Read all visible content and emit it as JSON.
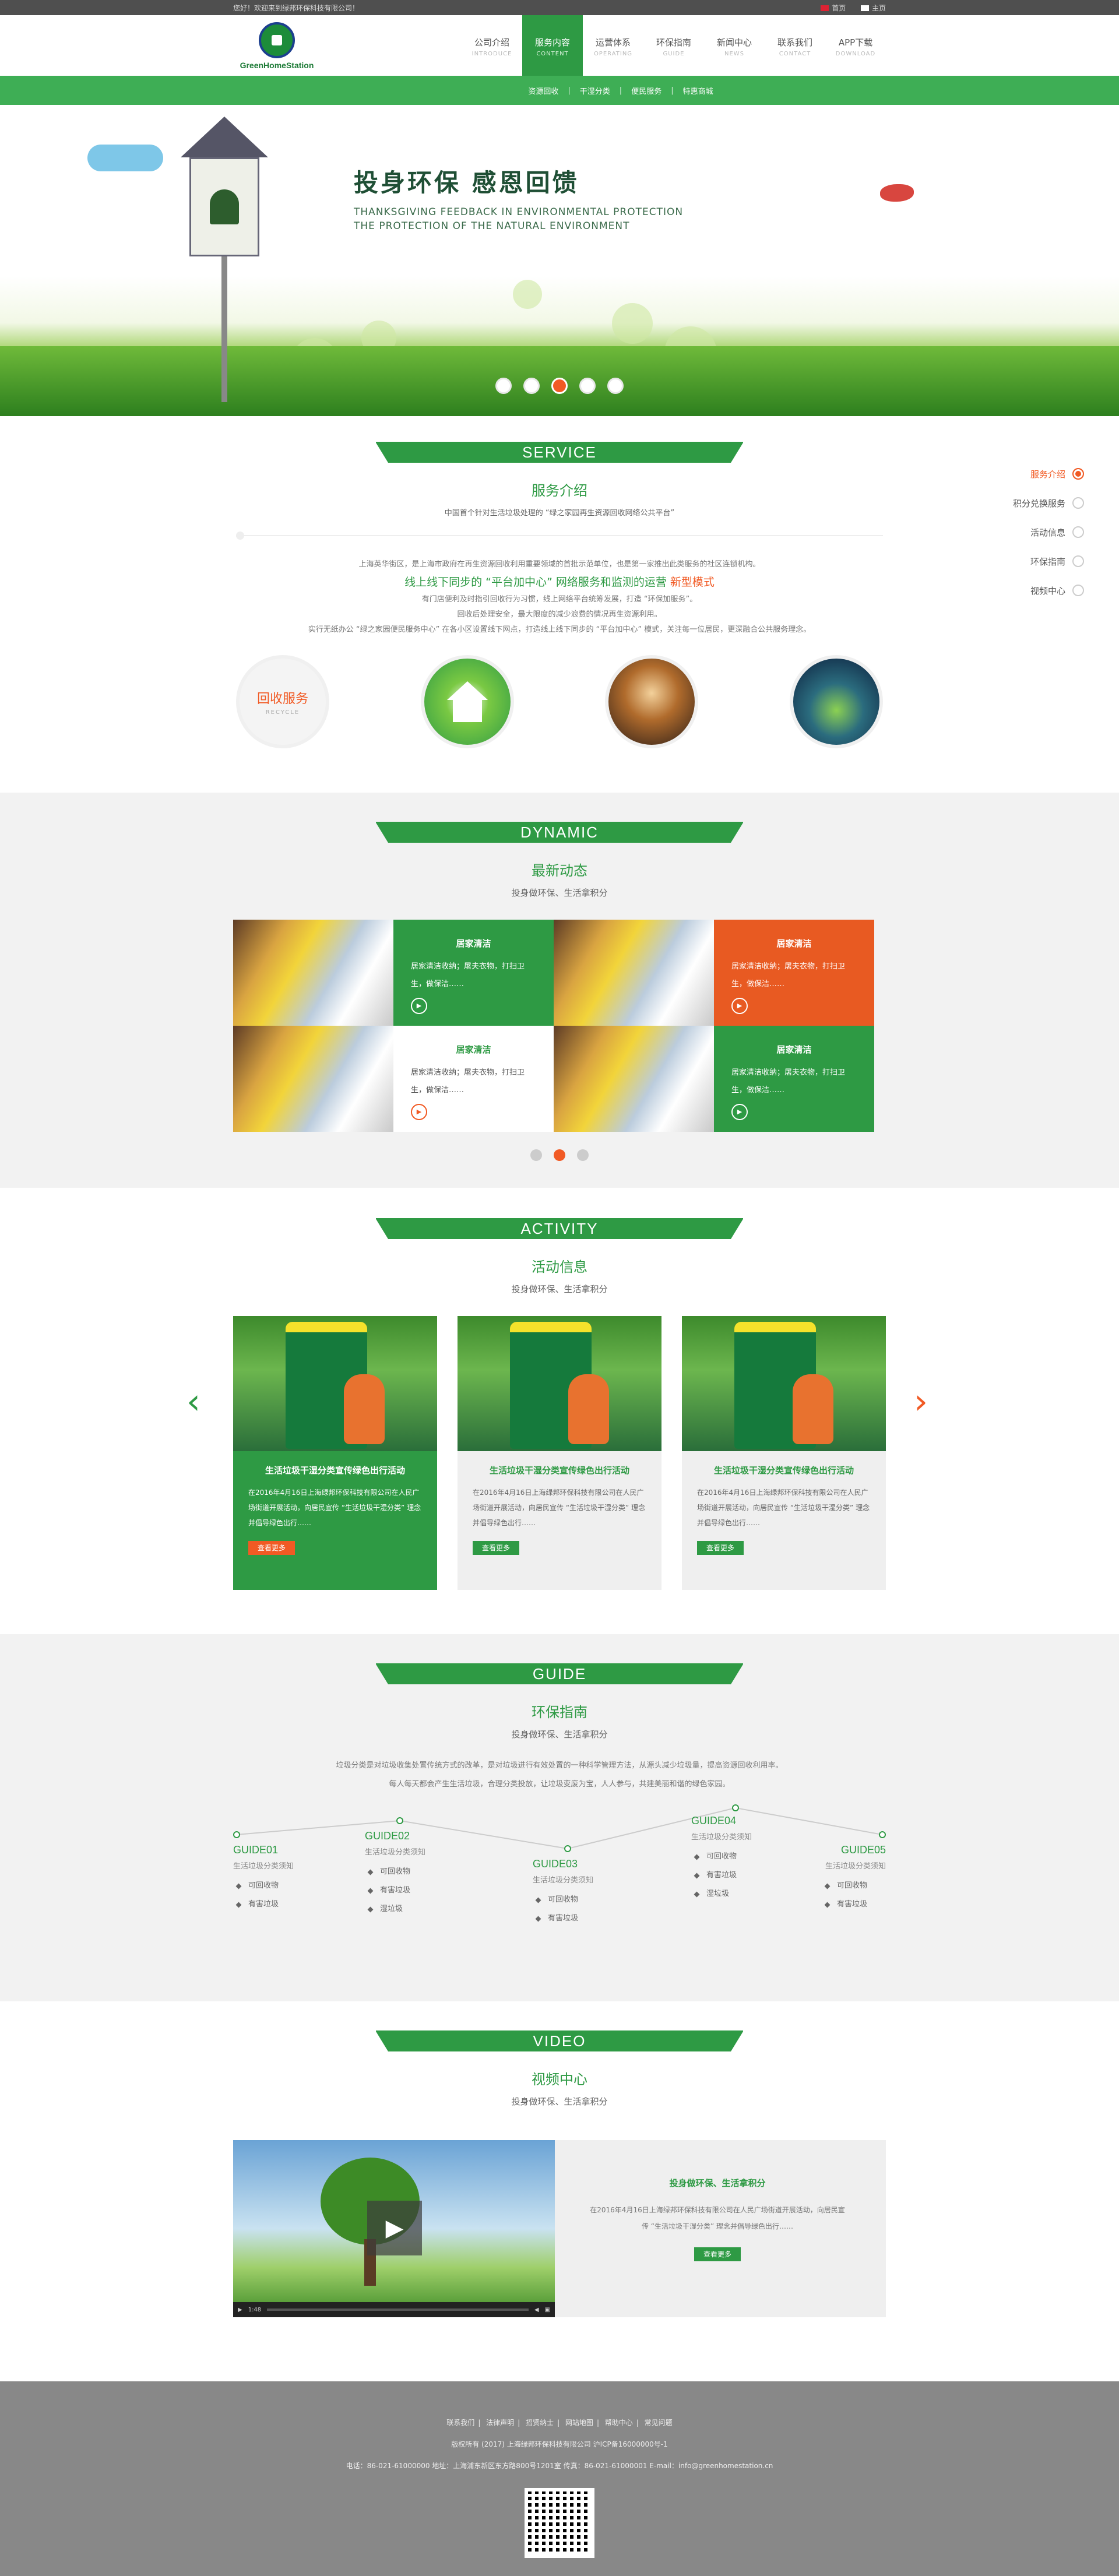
{
  "topbar": {
    "welcome": "您好！欢迎来到绿邦环保科技有限公司！",
    "lang_cn": "首页",
    "lang_en": "主页"
  },
  "logo": {
    "text": "GreenHomeStation"
  },
  "nav": [
    {
      "cn": "公司介绍",
      "en": "INTRODUCE"
    },
    {
      "cn": "服务内容",
      "en": "CONTENT"
    },
    {
      "cn": "运营体系",
      "en": "OPERATING"
    },
    {
      "cn": "环保指南",
      "en": "GUIDE"
    },
    {
      "cn": "新闻中心",
      "en": "NEWS"
    },
    {
      "cn": "联系我们",
      "en": "CONTACT"
    },
    {
      "cn": "APP下载",
      "en": "DOWNLOAD"
    }
  ],
  "subnav": [
    "资源回收",
    "干湿分类",
    "便民服务",
    "特惠商城"
  ],
  "banner": {
    "title": "投身环保 感恩回馈",
    "en1": "THANKSGIVING FEEDBACK IN ENVIRONMENTAL PROTECTION",
    "en2": "THE PROTECTION OF THE NATURAL ENVIRONMENT",
    "active_slide": 3
  },
  "service": {
    "ribbon": "SERVICE",
    "title": "服务介绍",
    "sub": "中国首个针对生活垃圾处理的 “绿之家园再生资源回收网络公共平台”",
    "p1": "上海英华街区，是上海市政府在再生资源回收利用重要领域的首批示范单位，也是第一家推出此类服务的社区连锁机构。",
    "highlight_a": "线上线下同步的 “平台加中心” 网络服务和监测的运营",
    "highlight_b": "新型模式",
    "p2": "有门店便利及时指引回收行为习惯，线上网络平台统筹发展，打造 “环保加服务”。",
    "p3": "回收后处理安全，最大限度的减少浪费的情况再生资源利用。",
    "p4": "实行无纸办公 “绿之家园便民服务中心” 在各小区设置线下网点，打造线上线下同步的 “平台加中心” 模式，关注每一位居民，更深融合公共服务理念。",
    "circle1": "回收服务",
    "circle1_en": "RECYCLE",
    "side": [
      "服务介绍",
      "积分兑换服务",
      "活动信息",
      "环保指南",
      "视频中心"
    ]
  },
  "dynamic": {
    "ribbon": "DYNAMIC",
    "title": "最新动态",
    "sub": "投身做环保、生活拿积分",
    "card_title": "居家清洁",
    "card_text": "居家清洁收纳；屠夫衣物，打扫卫生，做保洁……",
    "page": 2
  },
  "activity": {
    "ribbon": "ACTIVITY",
    "title": "活动信息",
    "sub": "投身做环保、生活拿积分",
    "item_title": "生活垃圾干湿分类宣传绿色出行活动",
    "item_text": "在2016年4月16日上海绿邦环保科技有限公司在人民广场街道开展活动，向居民宣传 “生活垃圾干湿分类” 理念并倡导绿色出行……",
    "more": "查看更多"
  },
  "guide": {
    "ribbon": "GUIDE",
    "title": "环保指南",
    "sub": "投身做环保、生活拿积分",
    "text1": "垃圾分类是对垃圾收集处置传统方式的改革，是对垃圾进行有效处置的一种科学管理方法，从源头减少垃圾量，提高资源回收利用率。",
    "text2": "每人每天都会产生生活垃圾，合理分类投放，让垃圾变废为宝，人人参与，共建美丽和谐的绿色家园。",
    "steps": [
      {
        "label": "GUIDE01",
        "sub": "生活垃圾分类须知",
        "items": [
          "可回收物",
          "有害垃圾"
        ]
      },
      {
        "label": "GUIDE02",
        "sub": "生活垃圾分类须知",
        "items": [
          "可回收物",
          "有害垃圾",
          "湿垃圾"
        ]
      },
      {
        "label": "GUIDE03",
        "sub": "生活垃圾分类须知",
        "items": [
          "可回收物",
          "有害垃圾"
        ]
      },
      {
        "label": "GUIDE04",
        "sub": "生活垃圾分类须知",
        "items": [
          "可回收物",
          "有害垃圾",
          "湿垃圾"
        ]
      },
      {
        "label": "GUIDE05",
        "sub": "生活垃圾分类须知",
        "items": [
          "可回收物",
          "有害垃圾"
        ]
      }
    ]
  },
  "video": {
    "ribbon": "VIDEO",
    "title": "视频中心",
    "sub": "投身做环保、生活拿积分",
    "info_title": "投身做环保、生活拿积分",
    "info_text": "在2016年4月16日上海绿邦环保科技有限公司在人民广场街道开展活动，向居民宣传 “生活垃圾干湿分类” 理念并倡导绿色出行……",
    "more": "查看更多",
    "time": "1:48"
  },
  "footer": {
    "links": [
      "联系我们",
      "法律声明",
      "招贤纳士",
      "网站地图",
      "帮助中心",
      "常见问题"
    ],
    "line1": "版权所有 (2017) 上海绿邦环保科技有限公司 沪ICP备16000000号-1",
    "line2": "电话：86-021-61000000  地址：上海浦东新区东方路800号1201室  传真：86-021-61000001  E-mail：info@greenhomestation.cn"
  },
  "colors": {
    "green": "#2e9a44",
    "orange": "#f15a24",
    "light_green": "#3eae55"
  }
}
